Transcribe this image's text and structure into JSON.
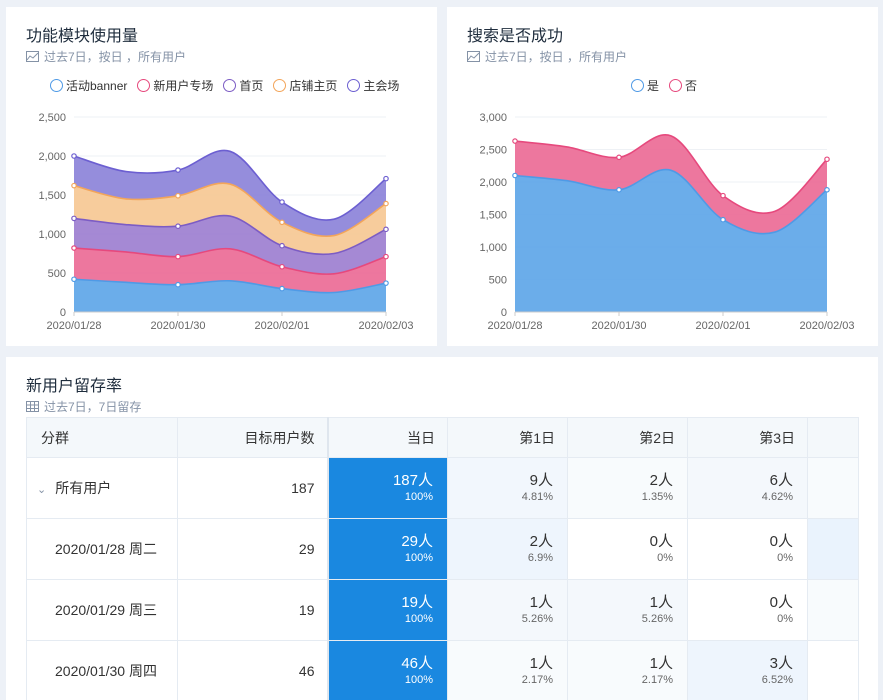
{
  "card1": {
    "title": "功能模块使用量",
    "subtitle": "过去7日，按日 ，所有用户",
    "legend": [
      "活动banner",
      "新用户专场",
      "首页",
      "店铺主页",
      "主会场"
    ]
  },
  "card2": {
    "title": "搜索是否成功",
    "subtitle": "过去7日，按日 ，所有用户",
    "legend": [
      "是",
      "否"
    ]
  },
  "card3": {
    "title": "新用户留存率",
    "subtitle": "过去7日，7日留存"
  },
  "colors": {
    "activity_banner": "#5ea6e8",
    "new_user": "#eb6b96",
    "home": "#9d7fd0",
    "shop": "#f6c894",
    "main_venue": "#8c83d9",
    "yes": "#5ea6e8",
    "no": "#eb6b96",
    "today_cell": "#1a88e0"
  },
  "chart_data": [
    {
      "type": "area",
      "stacked": true,
      "x": [
        "2020/01/28",
        "2020/01/29",
        "2020/01/30",
        "2020/01/31",
        "2020/02/01",
        "2020/02/02",
        "2020/02/03"
      ],
      "xticks": [
        "2020/01/28",
        "2020/01/30",
        "2020/02/01",
        "2020/02/03"
      ],
      "yticks": [
        "0",
        "500",
        "1,000",
        "1,500",
        "2,000",
        "2,500"
      ],
      "ylim": [
        0,
        2500
      ],
      "series": [
        {
          "name": "活动banner",
          "values": [
            420,
            380,
            350,
            400,
            300,
            250,
            370
          ]
        },
        {
          "name": "新用户专场",
          "values": [
            400,
            390,
            360,
            410,
            280,
            240,
            340
          ]
        },
        {
          "name": "首页",
          "values": [
            380,
            350,
            390,
            420,
            270,
            260,
            350
          ]
        },
        {
          "name": "店铺主页",
          "values": [
            420,
            330,
            390,
            410,
            300,
            230,
            330
          ]
        },
        {
          "name": "主会场",
          "values": [
            380,
            350,
            330,
            420,
            260,
            210,
            320
          ]
        }
      ]
    },
    {
      "type": "area",
      "stacked": true,
      "x": [
        "2020/01/28",
        "2020/01/29",
        "2020/01/30",
        "2020/01/31",
        "2020/02/01",
        "2020/02/02",
        "2020/02/03"
      ],
      "xticks": [
        "2020/01/28",
        "2020/01/30",
        "2020/02/01",
        "2020/02/03"
      ],
      "yticks": [
        "0",
        "500",
        "1,000",
        "1,500",
        "2,000",
        "2,500",
        "3,000"
      ],
      "ylim": [
        0,
        3000
      ],
      "series": [
        {
          "name": "是",
          "values": [
            2100,
            2020,
            1880,
            2180,
            1420,
            1230,
            1880
          ]
        },
        {
          "name": "否",
          "values": [
            530,
            520,
            500,
            530,
            370,
            320,
            470
          ]
        }
      ]
    }
  ],
  "table": {
    "headers": [
      "分群",
      "目标用户数",
      "当日",
      "第1日",
      "第2日",
      "第3日"
    ],
    "rows": [
      {
        "label": "所有用户",
        "total": "187",
        "cells": [
          [
            "187人",
            "100%"
          ],
          [
            "9人",
            "4.81%"
          ],
          [
            "2人",
            "1.35%"
          ],
          [
            "6人",
            "4.62%"
          ]
        ]
      },
      {
        "label": "2020/01/28 周二",
        "total": "29",
        "cells": [
          [
            "29人",
            "100%"
          ],
          [
            "2人",
            "6.9%"
          ],
          [
            "0人",
            "0%"
          ],
          [
            "0人",
            "0%"
          ]
        ]
      },
      {
        "label": "2020/01/29 周三",
        "total": "19",
        "cells": [
          [
            "19人",
            "100%"
          ],
          [
            "1人",
            "5.26%"
          ],
          [
            "1人",
            "5.26%"
          ],
          [
            "0人",
            "0%"
          ]
        ]
      },
      {
        "label": "2020/01/30 周四",
        "total": "46",
        "cells": [
          [
            "46人",
            "100%"
          ],
          [
            "1人",
            "2.17%"
          ],
          [
            "1人",
            "2.17%"
          ],
          [
            "3人",
            "6.52%"
          ]
        ]
      }
    ]
  }
}
